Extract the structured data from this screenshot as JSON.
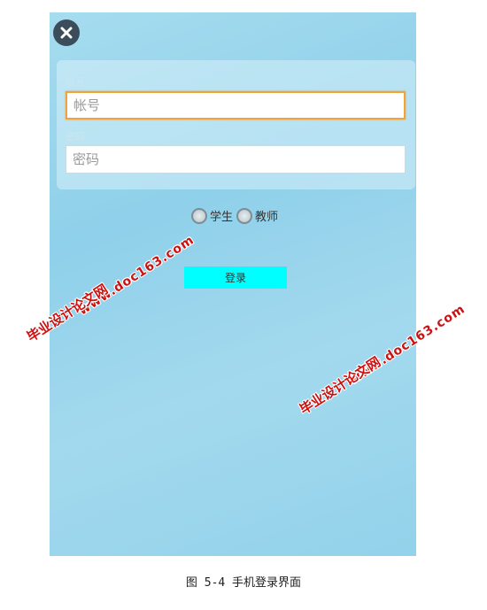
{
  "login": {
    "account_label": "帐号",
    "account_placeholder": "帐号",
    "password_label": "密码",
    "password_placeholder": "密码",
    "roles": [
      {
        "label": "学生"
      },
      {
        "label": "教师"
      }
    ],
    "login_button": "登录"
  },
  "watermarks": {
    "site_name": "毕业设计论文网",
    "url": "www.doc163.com"
  },
  "caption": "图 5-4 手机登录界面",
  "colors": {
    "background_gradient": [
      "#a6dcef",
      "#8fd0ea"
    ],
    "focused_border": "#f0a33c",
    "login_button": "#00ffff",
    "close_button": "#3b4d5b",
    "watermark": "#cc1111"
  },
  "icons": {
    "close": "close-icon"
  }
}
